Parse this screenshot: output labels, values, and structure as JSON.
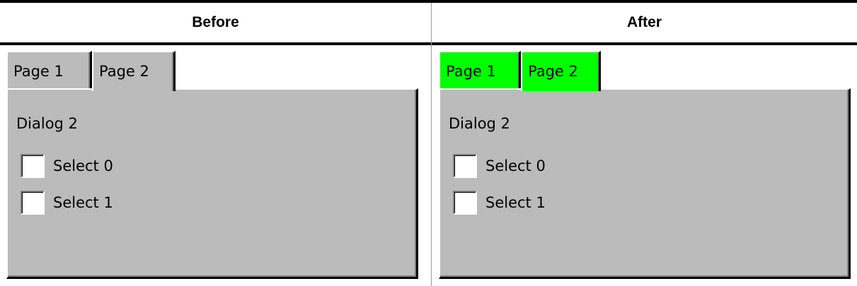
{
  "colors": {
    "panel_background": "#bbbbbb",
    "after_tab_background": "#00ff00",
    "text": "#000000"
  },
  "columns": [
    {
      "title": "Before",
      "tabs": [
        {
          "label": "Page 1",
          "selected": false
        },
        {
          "label": "Page 2",
          "selected": true
        }
      ],
      "dialog_label": "Dialog 2",
      "checkboxes": [
        {
          "label": "Select 0",
          "checked": false
        },
        {
          "label": "Select 1",
          "checked": false
        }
      ]
    },
    {
      "title": "After",
      "tabs": [
        {
          "label": "Page 1",
          "selected": false
        },
        {
          "label": "Page 2",
          "selected": true
        }
      ],
      "dialog_label": "Dialog 2",
      "checkboxes": [
        {
          "label": "Select 0",
          "checked": false
        },
        {
          "label": "Select 1",
          "checked": false
        }
      ]
    }
  ]
}
